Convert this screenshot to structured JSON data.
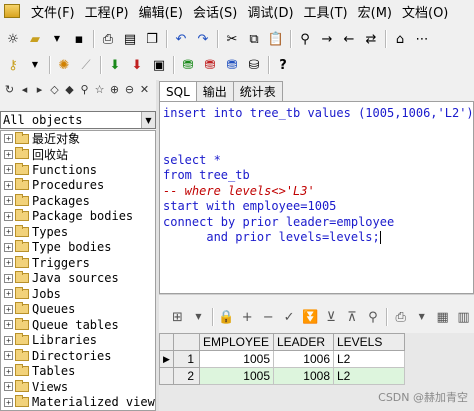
{
  "menubar": {
    "items": [
      "文件(F)",
      "工程(P)",
      "编辑(E)",
      "会话(S)",
      "调试(D)",
      "工具(T)",
      "宏(M)",
      "文档(O)"
    ]
  },
  "toolbar1": {
    "icons": [
      "new-icon",
      "open-icon",
      "save-icon",
      "print-icon",
      "print-preview-icon",
      "copy-icon",
      "undo-icon",
      "redo-icon",
      "cut-icon",
      "copy-icon",
      "paste-icon",
      "find-icon",
      "find-next-icon",
      "find-prev-icon",
      "replace-icon",
      "bookmark-icon"
    ]
  },
  "toolbar2": {
    "icons": [
      "key-icon",
      "debug-icon",
      "step-icon",
      "commit-icon",
      "rollback-icon",
      "log-icon",
      "explain-icon",
      "stats-icon",
      "plan-icon",
      "help-icon"
    ]
  },
  "objects_panel": {
    "filter_value": "All objects",
    "items": [
      "最近对象",
      "回收站",
      "Functions",
      "Procedures",
      "Packages",
      "Package bodies",
      "Types",
      "Type bodies",
      "Triggers",
      "Java sources",
      "Jobs",
      "Queues",
      "Queue tables",
      "Libraries",
      "Directories",
      "Tables",
      "Views",
      "Materialized view"
    ]
  },
  "tabs": [
    "SQL",
    "输出",
    "统计表"
  ],
  "active_tab": "SQL",
  "editor": {
    "lines": [
      "insert into tree_tb values (1005,1006,'L2');",
      "",
      "",
      "select *",
      "from tree_tb",
      "-- where levels<>'L3'",
      "start with employee=1005",
      "connect by prior leader=employee",
      "      and prior levels=levels;"
    ]
  },
  "result_grid": {
    "columns": [
      "EMPLOYEE",
      "LEADER",
      "LEVELS"
    ],
    "rows": [
      {
        "num": "1",
        "employee": "1005",
        "leader": "1006",
        "levels": "L2"
      },
      {
        "num": "2",
        "employee": "1005",
        "leader": "1008",
        "levels": "L2"
      }
    ]
  },
  "watermark": "CSDN @赫加青空"
}
